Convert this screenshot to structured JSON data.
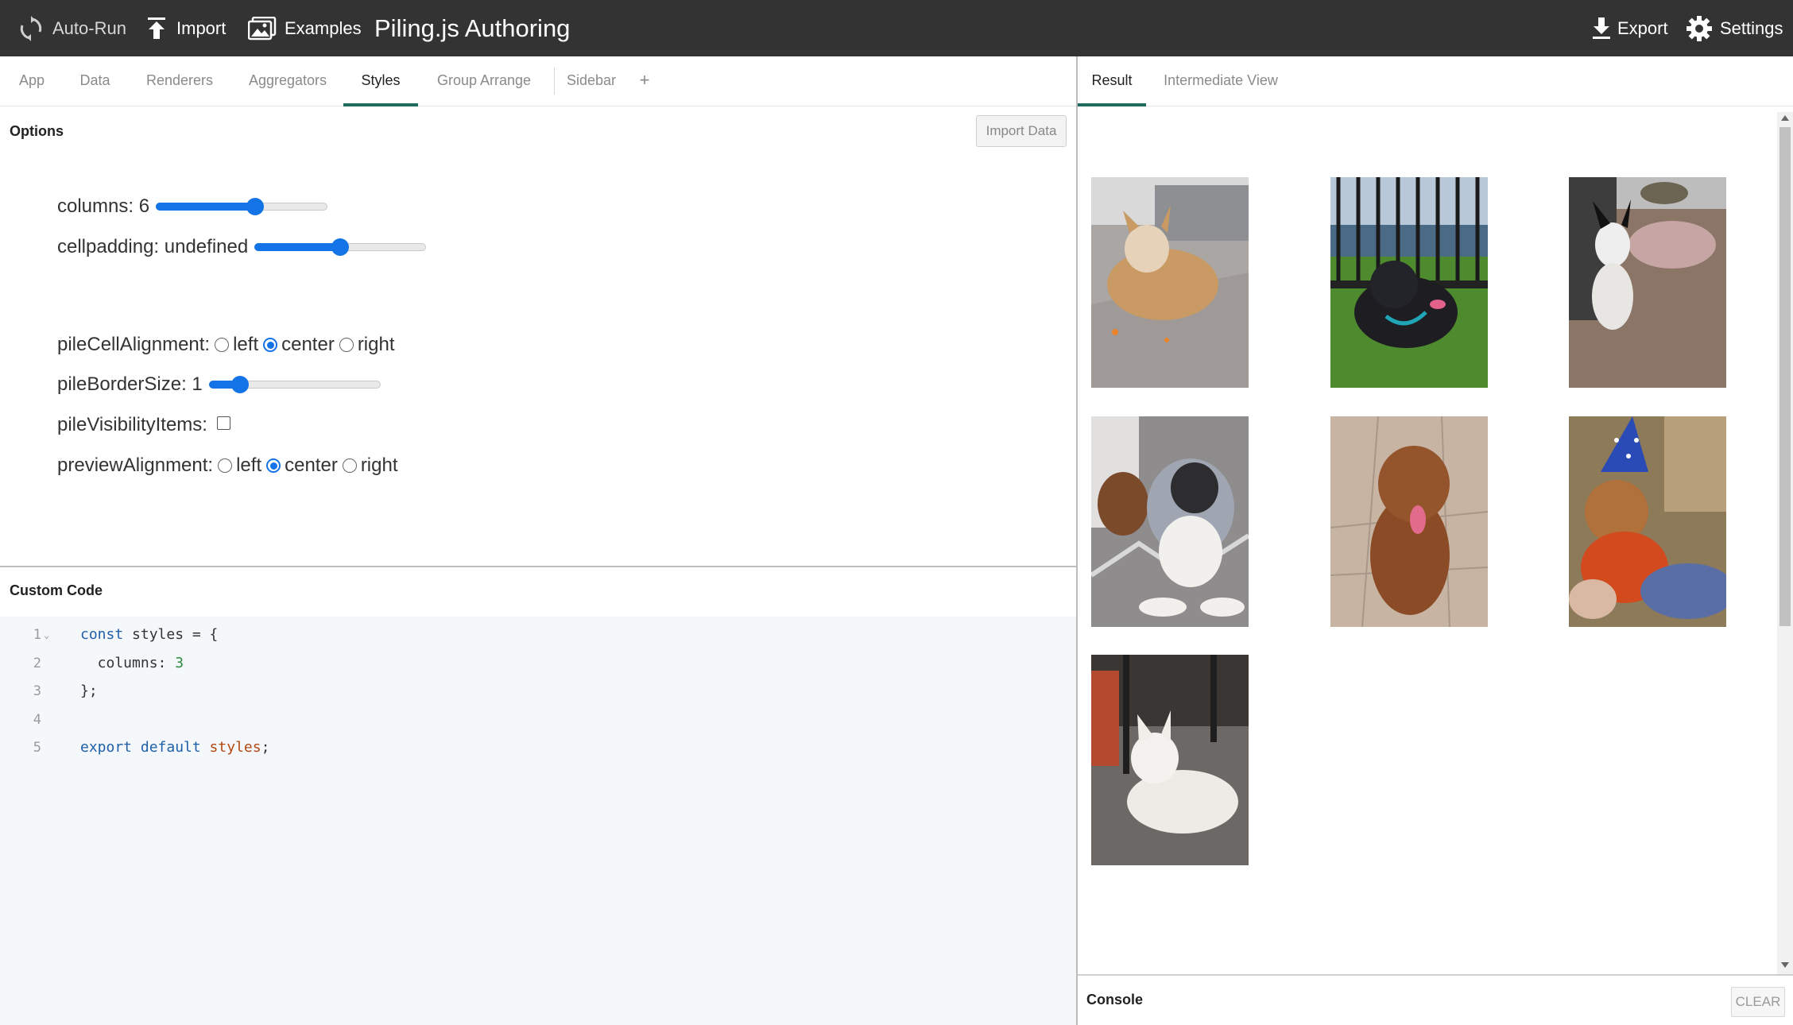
{
  "topbar": {
    "auto_run": "Auto-Run",
    "import": "Import",
    "examples": "Examples",
    "title": "Piling.js Authoring",
    "export": "Export",
    "settings": "Settings"
  },
  "left_tabs": [
    "App",
    "Data",
    "Renderers",
    "Aggregators",
    "Styles",
    "Group Arrange",
    "Sidebar",
    "+"
  ],
  "active_left_tab": "Styles",
  "options": {
    "title": "Options",
    "import_data_label": "Import Data",
    "columns": {
      "label": "columns: 6",
      "value": 6,
      "fraction": 0.58
    },
    "cellpadding": {
      "label": "cellpadding: undefined",
      "fraction": 0.5
    },
    "pile_cell_alignment": {
      "label": "pileCellAlignment:",
      "options": [
        "left",
        "center",
        "right"
      ],
      "selected": "center"
    },
    "pile_border_size": {
      "label": "pileBorderSize: 1",
      "value": 1,
      "fraction": 0.18
    },
    "pile_visibility_items": {
      "label": "pileVisibilityItems:",
      "checked": false
    },
    "preview_alignment": {
      "label": "previewAlignment:",
      "options": [
        "left",
        "center",
        "right"
      ],
      "selected": "center"
    }
  },
  "custom_code": {
    "title": "Custom Code",
    "line_numbers": [
      "1",
      "2",
      "3",
      "4",
      "5"
    ],
    "lines": {
      "l1_kw": "const",
      "l1_rest": " styles = {",
      "l2_prop": "  columns: ",
      "l2_num": "3",
      "l3": "};",
      "l5_kw": "export default",
      "l5_var": " styles",
      "l5_end": ";"
    }
  },
  "right_tabs": [
    "Result",
    "Intermediate View"
  ],
  "active_right_tab": "Result",
  "result_images": [
    "dog-photo-1",
    "dog-photo-2",
    "dog-photo-3",
    "dog-photo-4",
    "dog-photo-5",
    "dog-photo-6",
    "dog-photo-7"
  ],
  "console": {
    "title": "Console",
    "clear_label": "CLEAR"
  }
}
